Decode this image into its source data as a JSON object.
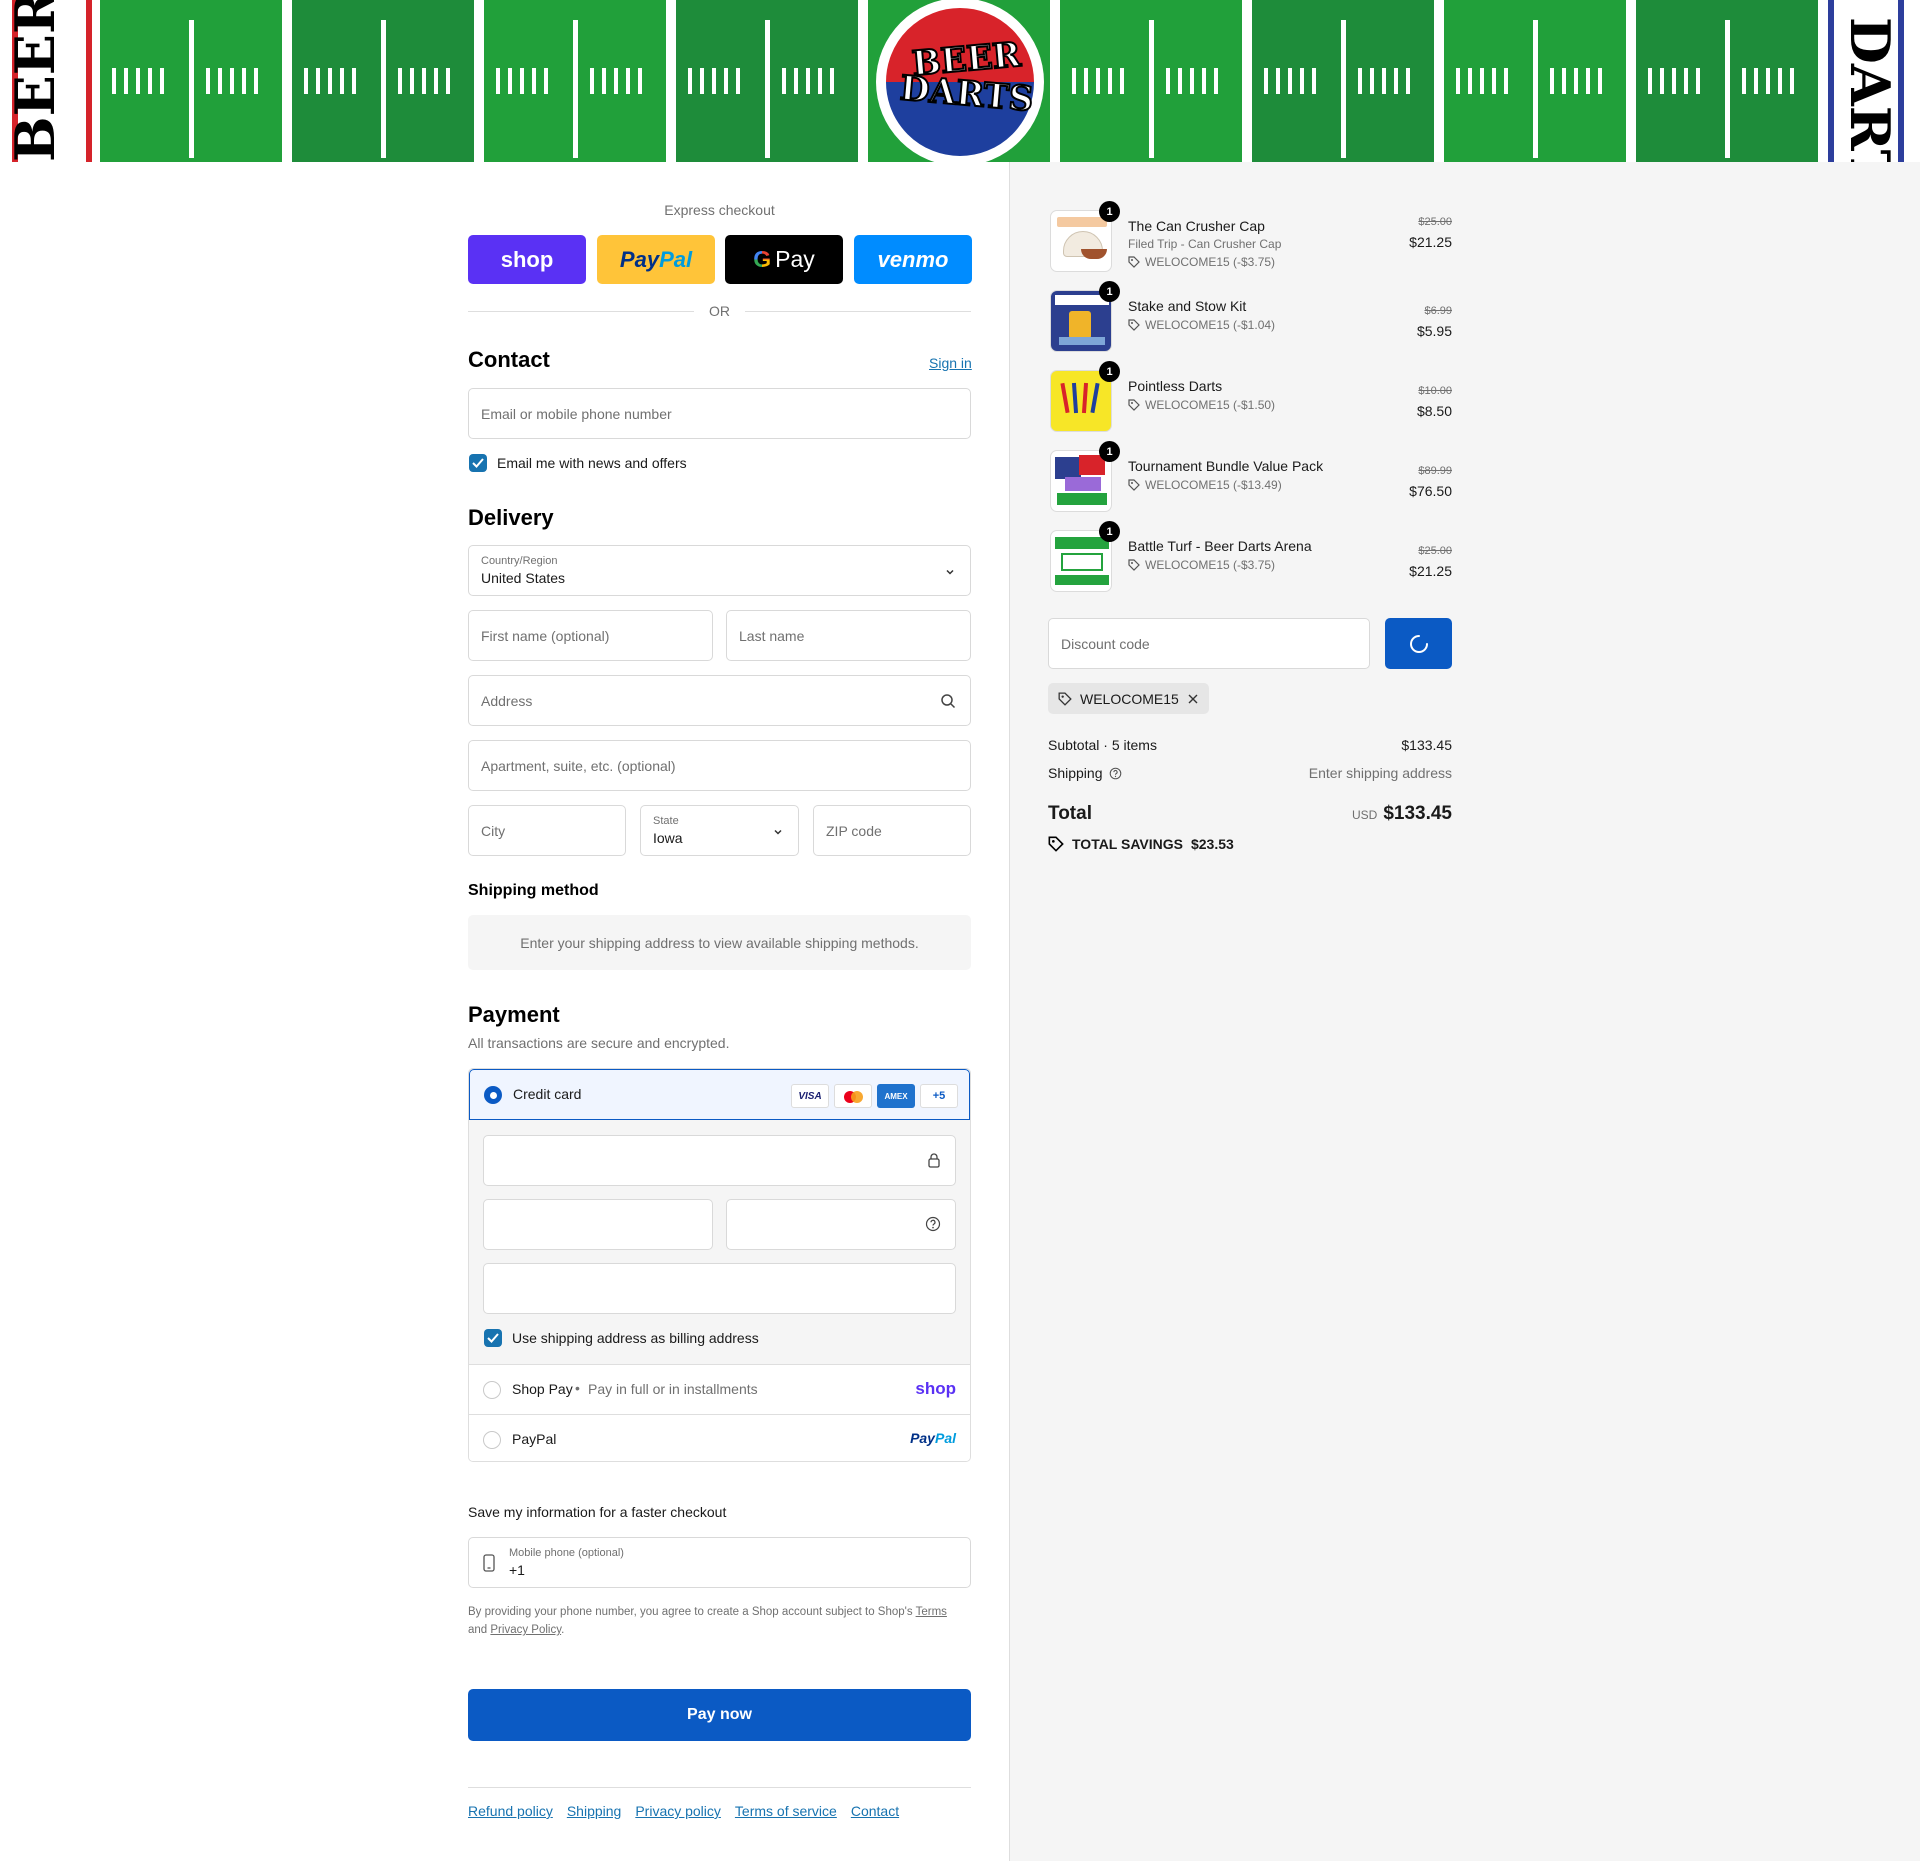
{
  "banner": {
    "logo_line1": "BEER",
    "logo_line2": "DARTS",
    "left_text": "BEER",
    "right_text": "DARTS"
  },
  "express": {
    "title": "Express checkout",
    "shop_label": "shop",
    "paypal_label_a": "Pay",
    "paypal_label_b": "Pal",
    "gpay_label": "Pay",
    "venmo_label": "venmo",
    "or_label": "OR"
  },
  "contact": {
    "title": "Contact",
    "sign_in": "Sign in",
    "email_placeholder": "Email or mobile phone number",
    "news_label": "Email me with news and offers"
  },
  "delivery": {
    "title": "Delivery",
    "country_label": "Country/Region",
    "country_value": "United States",
    "first_name_placeholder": "First name (optional)",
    "last_name_placeholder": "Last name",
    "address_placeholder": "Address",
    "apartment_placeholder": "Apartment, suite, etc. (optional)",
    "city_placeholder": "City",
    "state_label": "State",
    "state_value": "Iowa",
    "zip_placeholder": "ZIP code"
  },
  "shipping_method": {
    "title": "Shipping method",
    "notice": "Enter your shipping address to view available shipping methods."
  },
  "payment": {
    "title": "Payment",
    "subtitle": "All transactions are secure and encrypted.",
    "credit_card_label": "Credit card",
    "card_brands": [
      "VISA",
      "AMEX",
      "+5"
    ],
    "billing_label": "Use shipping address as billing address",
    "shop_pay_label": "Shop Pay",
    "shop_pay_sub": "Pay in full or in installments",
    "shop_pay_logo": "shop",
    "paypal_label": "PayPal",
    "paypal_logo_a": "Pay",
    "paypal_logo_b": "Pal"
  },
  "save_info": {
    "title": "Save my information for a faster checkout",
    "phone_label": "Mobile phone (optional)",
    "phone_value": "+1",
    "legal_prefix": "By providing your phone number, you agree to create a Shop account subject to Shop's",
    "terms": "Terms",
    "and": "and",
    "privacy": "Privacy Policy",
    "period": "."
  },
  "pay_now": "Pay now",
  "footer": [
    "Refund policy",
    "Shipping",
    "Privacy policy",
    "Terms of service",
    "Contact"
  ],
  "cart": {
    "items": [
      {
        "qty": "1",
        "name": "The Can Crusher Cap",
        "variant": "Filed Trip - Can Crusher Cap",
        "discount": "WELOCOME15 (-$3.75)",
        "old_price": "$25.00",
        "price": "$21.25"
      },
      {
        "qty": "1",
        "name": "Stake and Stow Kit",
        "variant": "",
        "discount": "WELOCOME15 (-$1.04)",
        "old_price": "$6.99",
        "price": "$5.95"
      },
      {
        "qty": "1",
        "name": "Pointless Darts",
        "variant": "",
        "discount": "WELOCOME15 (-$1.50)",
        "old_price": "$10.00",
        "price": "$8.50"
      },
      {
        "qty": "1",
        "name": "Tournament Bundle Value Pack",
        "variant": "",
        "discount": "WELOCOME15 (-$13.49)",
        "old_price": "$89.99",
        "price": "$76.50"
      },
      {
        "qty": "1",
        "name": "Battle Turf - Beer Darts Arena",
        "variant": "",
        "discount": "WELOCOME15 (-$3.75)",
        "old_price": "$25.00",
        "price": "$21.25"
      }
    ],
    "discount_placeholder": "Discount code",
    "applied_code": "WELOCOME15",
    "subtotal_label": "Subtotal · 5 items",
    "subtotal_value": "$133.45",
    "shipping_label": "Shipping",
    "shipping_value": "Enter shipping address",
    "total_label": "Total",
    "currency": "USD",
    "total_value": "$133.45",
    "savings_label": "TOTAL SAVINGS",
    "savings_value": "$23.53"
  },
  "colors": {
    "accent": "#0b5ac4",
    "link": "#1773b0",
    "shop_purple": "#5a31f4",
    "paypal_yellow": "#ffc439",
    "venmo_blue": "#008cff",
    "banner_green": "#24a33e"
  }
}
